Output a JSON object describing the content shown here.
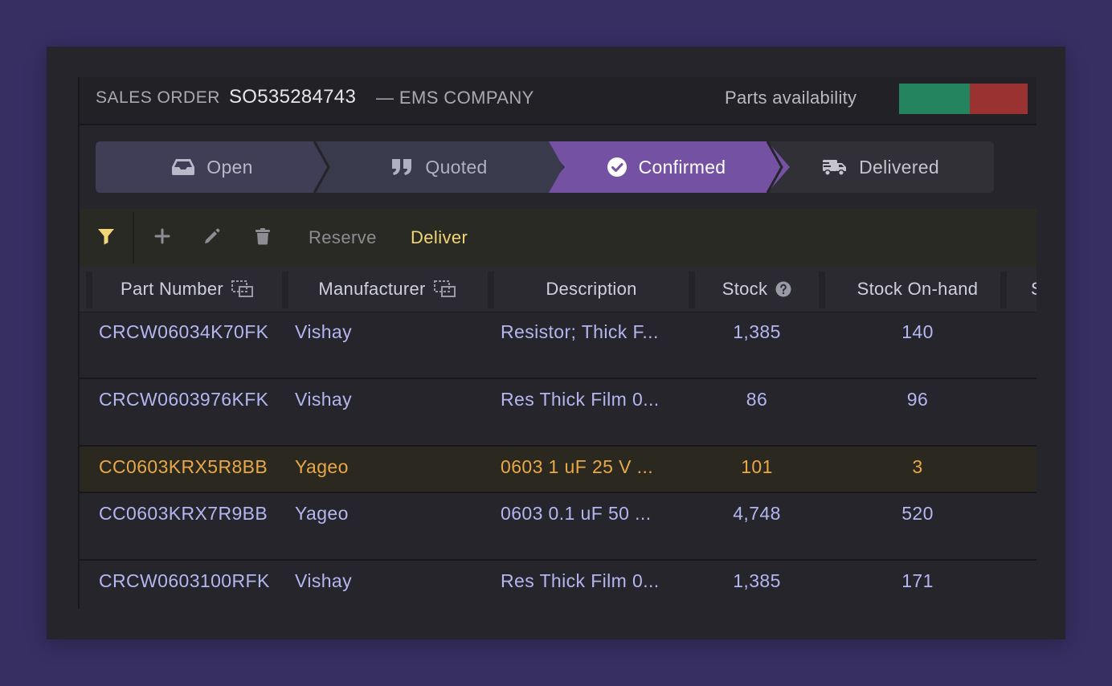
{
  "header": {
    "so_label": "SALES ORDER",
    "so_number": "SO535284743",
    "company": "— EMS COMPANY",
    "availability_label": "Parts availability",
    "availability": {
      "available_fraction": 0.55,
      "available_color": "#23845f",
      "missing_color": "#9b3232"
    }
  },
  "stepper": {
    "steps": [
      {
        "label": "Open",
        "icon": "inbox-icon"
      },
      {
        "label": "Quoted",
        "icon": "quote-icon"
      },
      {
        "label": "Confirmed",
        "icon": "check-circle-icon",
        "active": true
      },
      {
        "label": "Delivered",
        "icon": "truck-icon"
      }
    ]
  },
  "toolbar": {
    "filter_icon": "filter-icon",
    "add_icon": "plus-icon",
    "edit_icon": "pencil-icon",
    "delete_icon": "trash-icon",
    "reserve_label": "Reserve",
    "deliver_label": "Deliver"
  },
  "table": {
    "columns": {
      "part_number": "Part Number",
      "manufacturer": "Manufacturer",
      "description": "Description",
      "stock": "Stock",
      "stock_onhand": "Stock On-hand",
      "next": "S"
    },
    "rows": [
      {
        "part": "CRCW06034K70FK",
        "mfr": "Vishay",
        "desc": "Resistor; Thick F...",
        "stock": "1,385",
        "onhand": "140"
      },
      {
        "part": "CRCW0603976KFK",
        "mfr": "Vishay",
        "desc": "Res Thick Film 0...",
        "stock": "86",
        "onhand": "96"
      },
      {
        "part": "CC0603KRX5R8BB",
        "mfr": "Yageo",
        "desc": "0603 1 uF 25 V ...",
        "stock": "101",
        "onhand": "3",
        "highlighted": true
      },
      {
        "part": "CC0603KRX7R9BB",
        "mfr": "Yageo",
        "desc": "0603 0.1 uF 50 ...",
        "stock": "4,748",
        "onhand": "520"
      },
      {
        "part": "CRCW0603100RFK",
        "mfr": "Vishay",
        "desc": "Res Thick Film 0...",
        "stock": "1,385",
        "onhand": "171"
      }
    ]
  }
}
